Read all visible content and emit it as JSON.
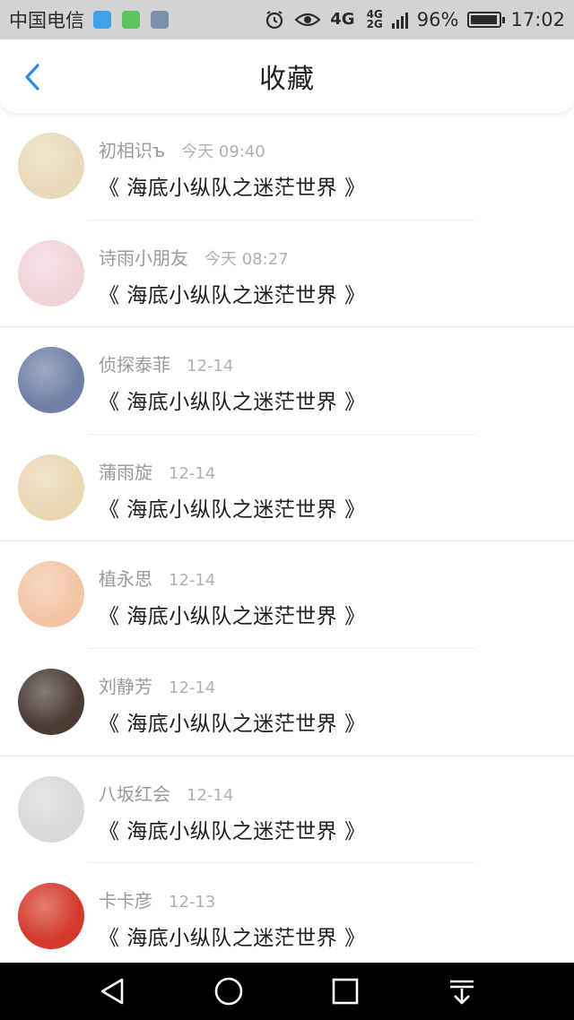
{
  "status_bar": {
    "carrier": "中国电信",
    "network": [
      "4G",
      "4G",
      "2G"
    ],
    "battery": "96%",
    "battery_level": 0.96,
    "time": "17:02"
  },
  "header": {
    "title": "收藏"
  },
  "items": [
    {
      "user": "初相识ъ",
      "time": "今天 09:40",
      "book": "《 海底小纵队之迷茫世界 》",
      "avatar_color": "#e8d9b8"
    },
    {
      "user": "诗雨小朋友",
      "time": "今天 08:27",
      "book": "《 海底小纵队之迷茫世界 》",
      "avatar_color": "#f1d3da"
    },
    {
      "user": "侦探泰菲",
      "time": "12-14",
      "book": "《 海底小纵队之迷茫世界 》",
      "avatar_color": "#6f7fa6"
    },
    {
      "user": "蒲雨旋",
      "time": "12-14",
      "book": "《 海底小纵队之迷茫世界 》",
      "avatar_color": "#e9d7b3"
    },
    {
      "user": "植永思",
      "time": "12-14",
      "book": "《 海底小纵队之迷茫世界 》",
      "avatar_color": "#f3c5a6"
    },
    {
      "user": "刘静芳",
      "time": "12-14",
      "book": "《 海底小纵队之迷茫世界 》",
      "avatar_color": "#4a3b33"
    },
    {
      "user": "八坂红会",
      "time": "12-14",
      "book": "《 海底小纵队之迷茫世界 》",
      "avatar_color": "#d9d9d9"
    },
    {
      "user": "卡卡彦",
      "time": "12-13",
      "book": "《 海底小纵队之迷茫世界 》",
      "avatar_color": "#d43a2c"
    }
  ],
  "colors": {
    "accent": "#2a8be8",
    "status_bar_bg": "#d3d3d3",
    "nav_bg": "#000000"
  }
}
